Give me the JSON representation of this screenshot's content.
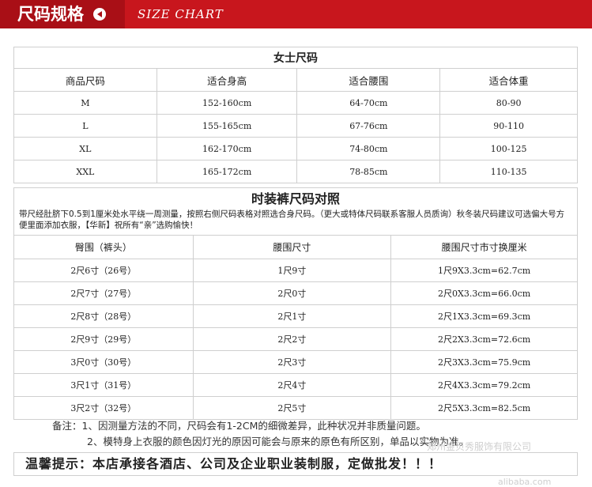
{
  "header": {
    "title_cn": "尺码规格",
    "title_en": "SIZE CHART"
  },
  "women": {
    "title": "女士尺码",
    "columns": [
      "商品尺码",
      "适合身高",
      "适合腰围",
      "适合体重"
    ],
    "rows": [
      [
        "M",
        "152-160cm",
        "64-70cm",
        "80-90"
      ],
      [
        "L",
        "155-165cm",
        "67-76cm",
        "90-110"
      ],
      [
        "XL",
        "162-170cm",
        "74-80cm",
        "100-125"
      ],
      [
        "XXL",
        "165-172cm",
        "78-85cm",
        "110-135"
      ]
    ]
  },
  "pants": {
    "title": "时装裤尺码对照",
    "note": "带尺经肚脐下0.5到1厘米处水平绕一周测量，按照右侧尺码表格对照选合身尺码。（更大或特体尺码联系客服人员质询）秋冬装尺码建议可选偏大号方便里面添加衣服，【华新】祝所有“亲”选购愉快！",
    "columns": [
      "臀围（裤头）",
      "腰围尺寸",
      "腰围尺寸市寸换厘米"
    ],
    "rows": [
      [
        "2尺6寸（26号）",
        "1尺9寸",
        "1尺9X3.3cm=62.7cm"
      ],
      [
        "2尺7寸（27号）",
        "2尺0寸",
        "2尺0X3.3cm=66.0cm"
      ],
      [
        "2尺8寸（28号）",
        "2尺1寸",
        "2尺1X3.3cm=69.3cm"
      ],
      [
        "2尺9寸（29号）",
        "2尺2寸",
        "2尺2X3.3cm=72.6cm"
      ],
      [
        "3尺0寸（30号）",
        "2尺3寸",
        "2尺3X3.3cm=75.9cm"
      ],
      [
        "3尺1寸（31号）",
        "2尺4寸",
        "2尺4X3.3cm=79.2cm"
      ],
      [
        "3尺2寸（32号）",
        "2尺5寸",
        "2尺5X3.3cm=82.5cm"
      ]
    ]
  },
  "remarks": {
    "line1": "备注：1、因测量方法的不同，尺码会有1-2CM的细微差异，此种状况并非质量问题。",
    "line2": "2、模特身上衣服的颜色因灯光的原因可能会与原来的原色有所区别，单品以实物为准。"
  },
  "warm_tip": "温馨提示：本店承接各酒店、公司及企业职业装制服，定做批发！！！",
  "watermark": {
    "text1": "郑州金贝秀服饰有限公司",
    "text2": "alibaba.com"
  },
  "colors": {
    "header_red": "#c8161d",
    "header_dark": "#a90f16",
    "border": "#cfcfcf"
  }
}
